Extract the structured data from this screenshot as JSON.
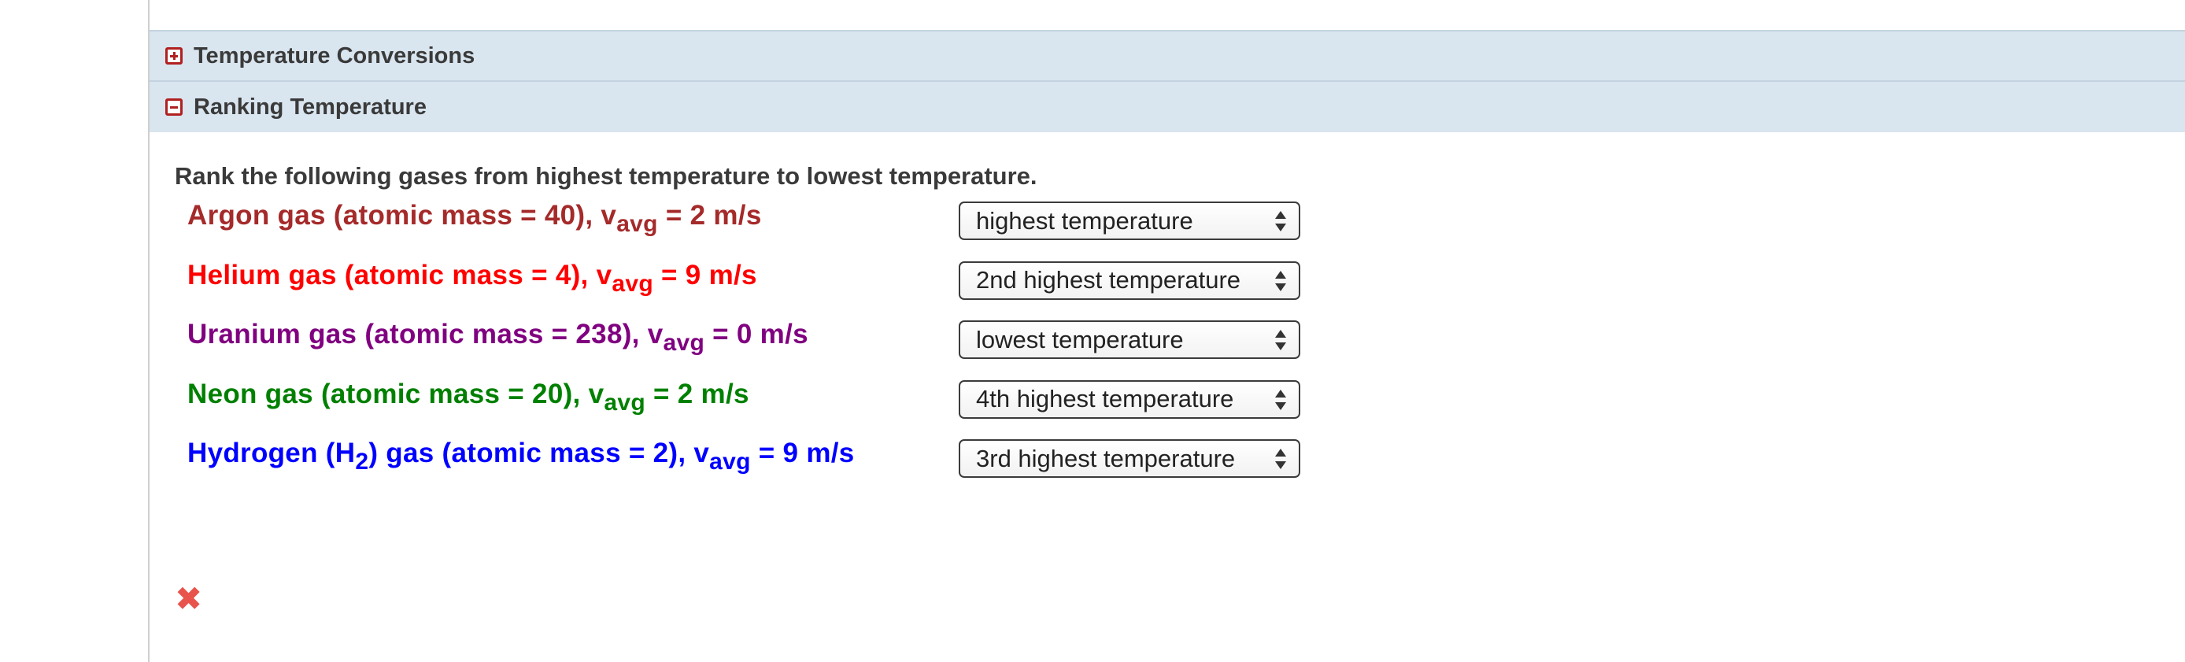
{
  "sections": [
    {
      "title": "Temperature Conversions",
      "state": "collapsed",
      "icon": "plus-box-icon"
    },
    {
      "title": "Ranking Temperature",
      "state": "expanded",
      "icon": "minus-box-icon"
    }
  ],
  "ranking": {
    "instructions": "Rank the following gases from highest temperature to lowest temperature.",
    "items": [
      {
        "color": "#a52a2a",
        "label_pre": "Argon gas (atomic mass = 40), v",
        "v_sub": "avg",
        "label_post": " = 2 m/s",
        "selected": "highest temperature"
      },
      {
        "color": "#ff0000",
        "label_pre": "Helium gas (atomic mass = 4), v",
        "v_sub": "avg",
        "label_post": " = 9 m/s",
        "selected": "2nd highest temperature"
      },
      {
        "color": "#800080",
        "label_pre": "Uranium gas (atomic mass = 238), v",
        "v_sub": "avg",
        "label_post": " = 0 m/s",
        "selected": "lowest temperature"
      },
      {
        "color": "#008000",
        "label_pre": "Neon gas (atomic mass = 20), v",
        "v_sub": "avg",
        "label_post": " = 2 m/s",
        "selected": "4th highest temperature"
      },
      {
        "color": "#0000ff",
        "label_a": "Hydrogen (H",
        "h_sub": "2",
        "label_b": ") gas (atomic mass = 2), v",
        "v_sub": "avg",
        "label_post": " = 9 m/s",
        "selected": "3rd highest temperature"
      }
    ]
  },
  "status": {
    "icon": "red-x-icon",
    "glyph": "✖",
    "color": "#e8534b"
  }
}
